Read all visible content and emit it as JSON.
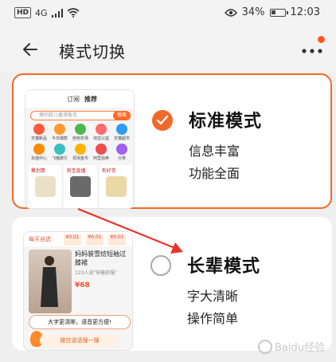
{
  "status_bar": {
    "hd_badge": "HD",
    "network": "4G",
    "battery_text": "34%",
    "battery_level": 0.34,
    "time": "12:03"
  },
  "header": {
    "title": "模式切换",
    "back_icon": "arrow-left-icon",
    "more_icon": "more-dots-icon"
  },
  "modes": [
    {
      "title": "标准模式",
      "lines": [
        "信息丰富",
        "功能全面"
      ],
      "selected": true,
      "preview": {
        "tabs": [
          "订阅",
          "推荐"
        ],
        "search_placeholder": "搜同款儿童滑板车",
        "search_button": "搜索",
        "icons": [
          "天猫新品",
          "今日爆款",
          "芭芭农场",
          "淘宝公益",
          "天猫超市",
          "充值中心",
          "飞猪旅行",
          "领淘金币",
          "阿里拍卖",
          "分类"
        ],
        "promos": [
          "聚划算",
          "淘宝直播",
          "有好货"
        ]
      }
    },
    {
      "title": "长辈模式",
      "lines": [
        "字大清晰",
        "操作简单"
      ],
      "selected": false,
      "preview": {
        "tag": "每天自选",
        "prices": [
          "¥0.01",
          "¥0.01",
          "¥0.01"
        ],
        "product_name": "妈妈装雪纺短袖过膝裙",
        "product_sub": "123人说\"穿着舒服\"",
        "product_price": "¥68",
        "bubble": "大字更清晰，语音更方便!",
        "voice_button": "按住说话搜一搜"
      }
    }
  ],
  "watermark": "Baidu经验",
  "colors": {
    "accent": "#ef6a2a",
    "annotation_arrow": "#e8342a"
  }
}
